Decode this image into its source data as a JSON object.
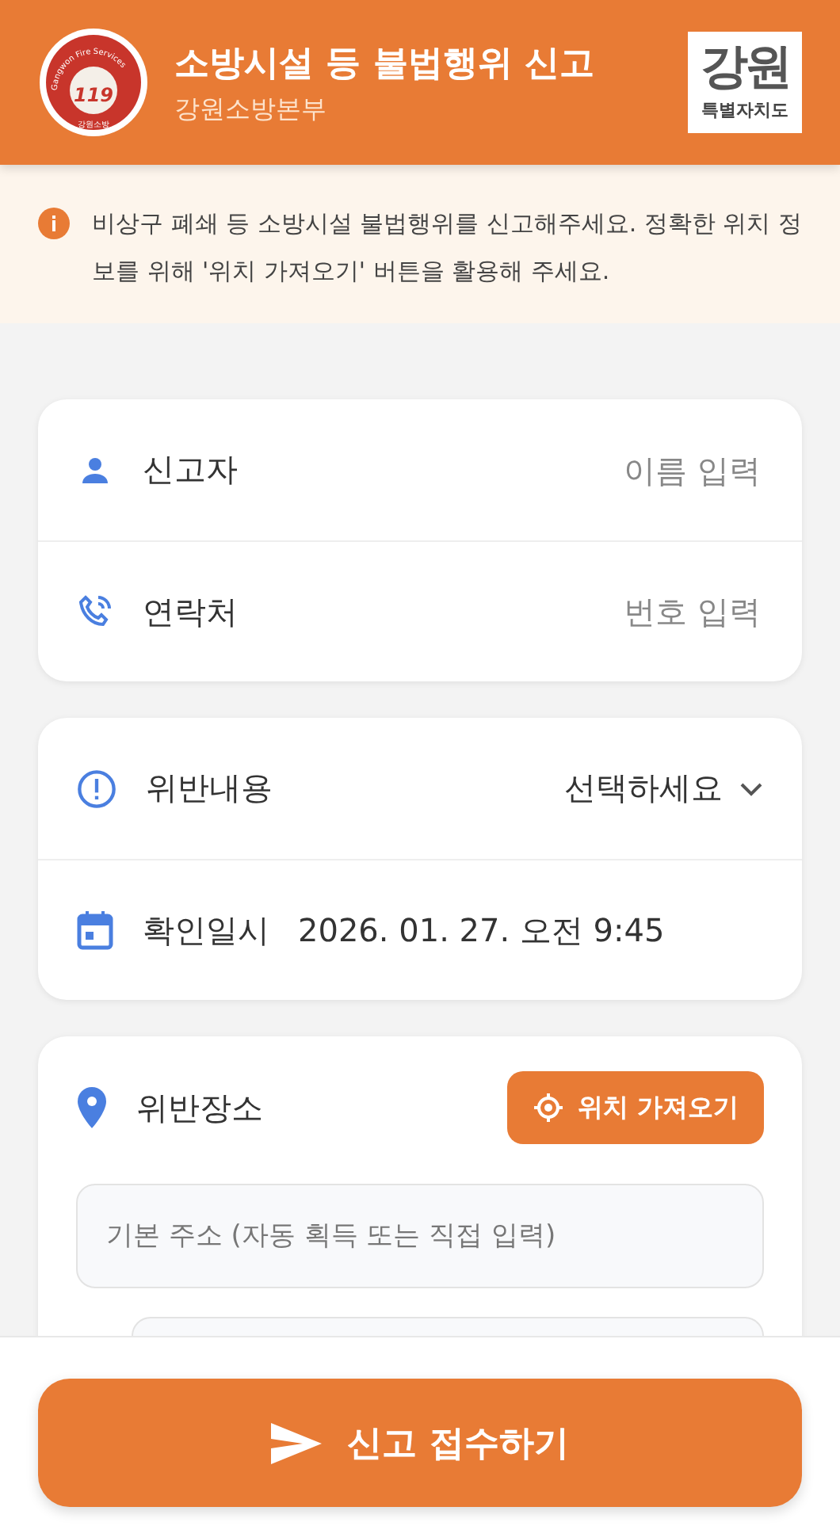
{
  "header": {
    "title": "소방시설 등 불법행위 신고",
    "subtitle": "강원소방본부",
    "emblem": {
      "arc_text": "Gangwon Fire Services",
      "number": "119",
      "caption": "강원소방"
    },
    "region_logo": {
      "main": "강원",
      "sub": "특별자치도"
    }
  },
  "notice": {
    "text": "비상구 폐쇄 등 소방시설 불법행위를 신고해주세요. 정확한 위치 정보를 위해 '위치 가져오기' 버튼을 활용해 주세요."
  },
  "cards": [
    {
      "rows": [
        {
          "kind": "input",
          "label": "신고자",
          "placeholder": "이름 입력"
        },
        {
          "kind": "input",
          "label": "연락처",
          "placeholder": "번호 입력"
        }
      ]
    },
    {
      "rows": [
        {
          "kind": "select",
          "label": "위반내용",
          "value": "선택하세요"
        },
        {
          "kind": "datetime",
          "label": "확인일시",
          "value": "2026. 01. 27. 오전 9:45"
        }
      ]
    }
  ],
  "location": {
    "label": "위반장소",
    "button": "위치 가져오기",
    "address_placeholder": "기본 주소 (자동 획득 또는 직접 입력)"
  },
  "submit": {
    "label": "신고 접수하기"
  }
}
